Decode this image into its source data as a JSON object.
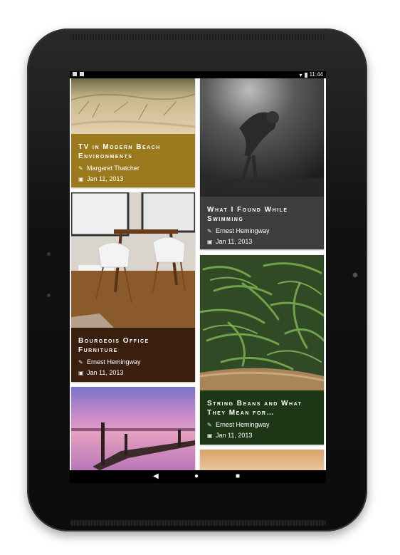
{
  "status_bar": {
    "time": "11:44"
  },
  "cards": [
    {
      "title": "TV in Modern Beach Environments",
      "author": "Margaret Thatcher",
      "date": "Jan 11, 2013",
      "color": "#9b7a1e"
    },
    {
      "title": "What I Found While Swimming",
      "author": "Ernest Hemingway",
      "date": "Jan 11, 2013",
      "color": "#3e3e3e"
    },
    {
      "title": "Bourgeois Office Furniture",
      "author": "Ernest Hemingway",
      "date": "Jan 11, 2013",
      "color": "#3a1e0e"
    },
    {
      "title": "String Beans and What They Mean for…",
      "author": "Ernest Hemingway",
      "date": "Jan 11, 2013",
      "color": "#1d3716"
    }
  ],
  "nav": {
    "back": "◀",
    "home": "●",
    "recents": "■"
  },
  "icons": {
    "author": "pen-icon",
    "date": "calendar-icon"
  }
}
